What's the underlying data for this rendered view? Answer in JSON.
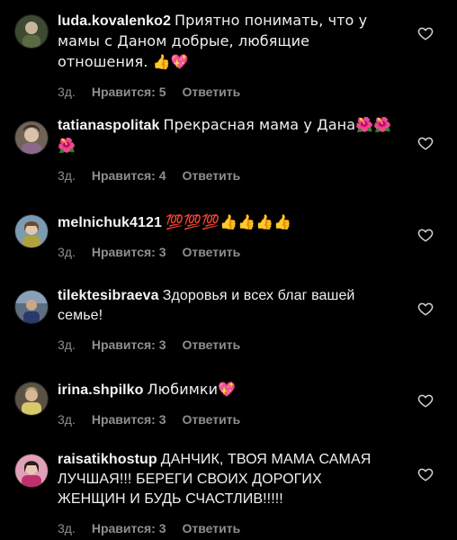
{
  "comments": [
    {
      "username": "luda.kovalenko2",
      "text": "Приятно понимать, что у мамы с Даном добрые, любящие отношения. 👍💖",
      "time": "3д.",
      "likes": "Нравится: 5",
      "reply": "Ответить",
      "avatar_color": "#4a5a3a"
    },
    {
      "username": "tatianaspolitak",
      "text": "Прекрасная мама у Дана🌺🌺🌺",
      "time": "3д.",
      "likes": "Нравится: 4",
      "reply": "Ответить",
      "avatar_color": "#8a7a6a"
    },
    {
      "username": "melnichuk4121",
      "text": "💯💯💯👍👍👍👍",
      "time": "3д.",
      "likes": "Нравится: 3",
      "reply": "Ответить",
      "avatar_color": "#6a8aa0"
    },
    {
      "username": "tilektesibraeva",
      "text": "Здоровья и всех благ вашей семье!",
      "time": "3д.",
      "likes": "Нравится: 3",
      "reply": "Ответить",
      "avatar_color": "#5a6a7a"
    },
    {
      "username": "irina.shpilko",
      "text": "Любимки💖",
      "time": "3д.",
      "likes": "Нравится: 3",
      "reply": "Ответить",
      "avatar_color": "#7a7060"
    },
    {
      "username": "raisatikhostup",
      "text": "ДАНЧИК, ТВОЯ МАМА САМАЯ ЛУЧШАЯ!!! БЕРЕГИ СВОИХ ДОРОГИХ ЖЕНЩИН И БУДЬ СЧАСТЛИВ!!!!!",
      "time": "3д.",
      "likes": "Нравится: 3",
      "reply": "Ответить",
      "avatar_color": "#b04a6a"
    }
  ]
}
